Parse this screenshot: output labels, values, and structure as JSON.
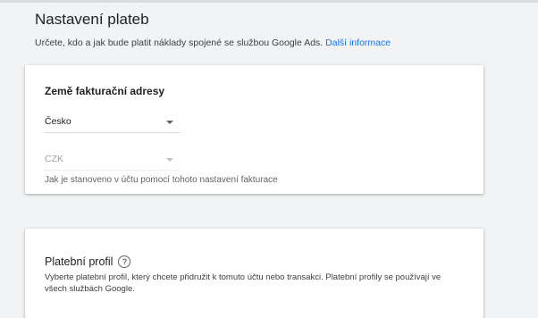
{
  "header": {
    "title": "Nastavení plateb",
    "subtitle": "Určete, kdo a jak bude platit náklady spojené se službou Google Ads.",
    "more_info_link": "Další informace"
  },
  "billing_country_card": {
    "title": "Země fakturační adresy",
    "country_select": {
      "value": "Česko"
    },
    "currency_select": {
      "value": "CZK",
      "disabled": true
    },
    "hint": "Jak je stanoveno v účtu pomocí tohoto nastavení fakturace"
  },
  "payment_profile_card": {
    "title": "Platební profil",
    "help_icon_glyph": "?",
    "description": "Vyberte platební profil, který chcete přidružit k tomuto účtu nebo transakci. Platební profily se používají ve všech službách Google."
  }
}
